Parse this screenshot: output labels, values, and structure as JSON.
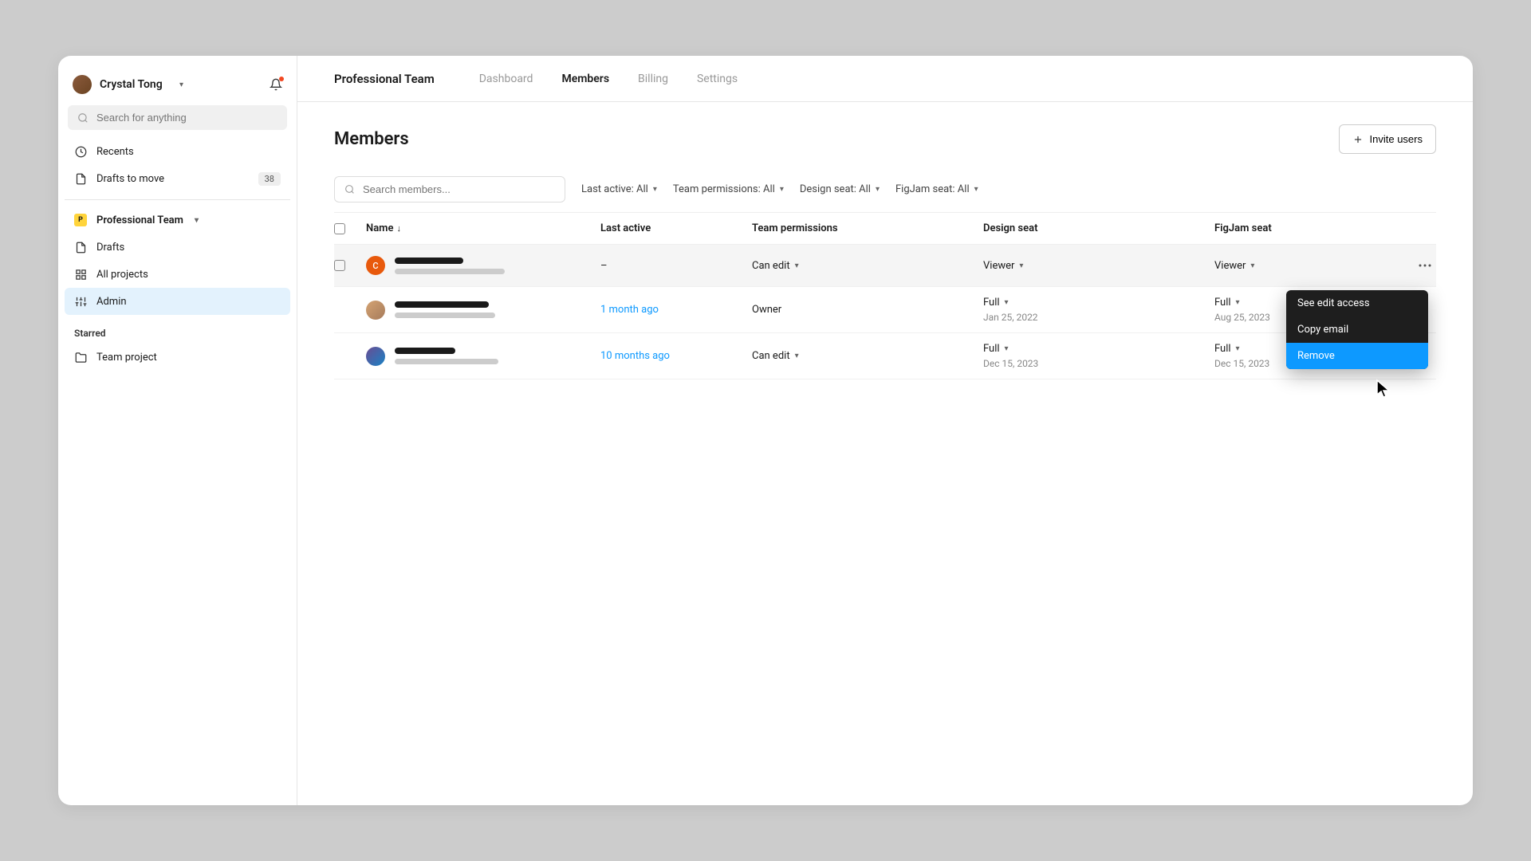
{
  "user": {
    "name": "Crystal Tong"
  },
  "search": {
    "placeholder": "Search for anything"
  },
  "nav": {
    "recents": "Recents",
    "drafts_to_move": "Drafts to move",
    "drafts_badge": "38",
    "team_name": "Professional Team",
    "drafts": "Drafts",
    "all_projects": "All projects",
    "admin": "Admin"
  },
  "starred": {
    "label": "Starred",
    "items": [
      "Team project"
    ]
  },
  "topbar": {
    "team": "Professional Team",
    "tabs": {
      "dashboard": "Dashboard",
      "members": "Members",
      "billing": "Billing",
      "settings": "Settings"
    }
  },
  "page": {
    "title": "Members",
    "invite": "Invite users",
    "search_placeholder": "Search members..."
  },
  "filters": {
    "last_active": "Last active: All",
    "team_permissions": "Team permissions: All",
    "design_seat": "Design seat: All",
    "figjam_seat": "FigJam seat: All"
  },
  "columns": {
    "name": "Name",
    "last_active": "Last active",
    "team_permissions": "Team permissions",
    "design_seat": "Design seat",
    "figjam_seat": "FigJam seat"
  },
  "rows": [
    {
      "avatar_letter": "C",
      "last_active": "–",
      "permission": "Can edit",
      "design": "Viewer",
      "design_date": "",
      "figjam": "Viewer",
      "figjam_date": ""
    },
    {
      "last_active": "1 month ago",
      "permission": "Owner",
      "design": "Full",
      "design_date": "Jan 25, 2022",
      "figjam": "Full",
      "figjam_date": "Aug 25, 2023"
    },
    {
      "last_active": "10 months ago",
      "permission": "Can edit",
      "design": "Full",
      "design_date": "Dec 15, 2023",
      "figjam": "Full",
      "figjam_date": "Dec 15, 2023"
    }
  ],
  "context_menu": {
    "see_edit": "See edit access",
    "copy_email": "Copy email",
    "remove": "Remove"
  }
}
